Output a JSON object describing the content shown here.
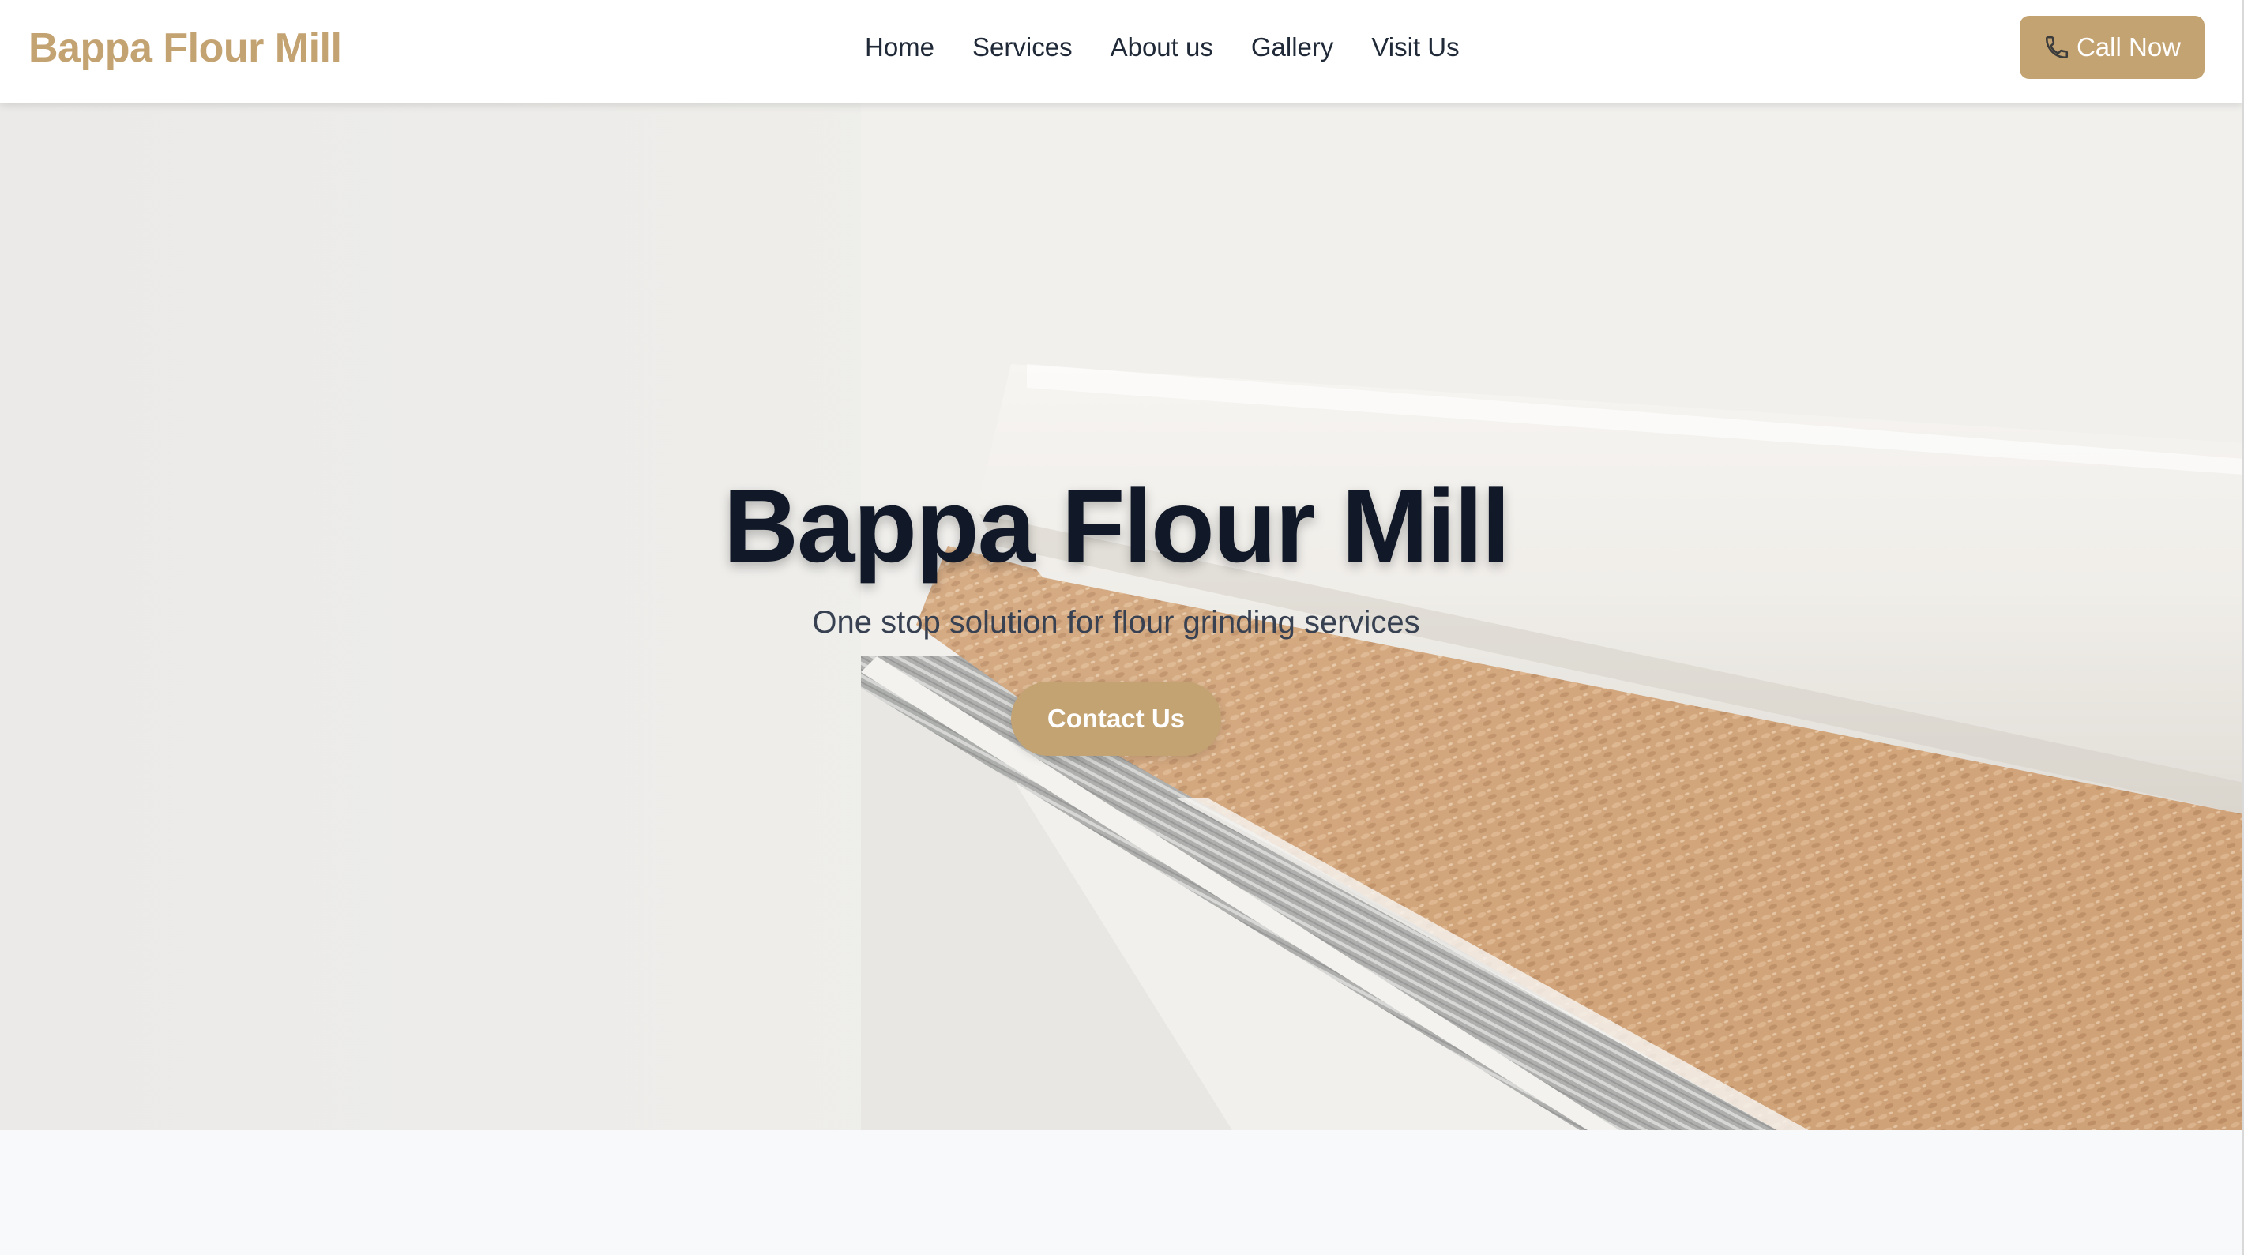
{
  "header": {
    "brand": "Bappa Flour Mill",
    "nav": [
      {
        "label": "Home"
      },
      {
        "label": "Services"
      },
      {
        "label": "About us"
      },
      {
        "label": "Gallery"
      },
      {
        "label": "Visit Us"
      }
    ],
    "call_button": {
      "label": "Call Now",
      "icon": "phone-icon"
    }
  },
  "hero": {
    "title": "Bappa Flour Mill",
    "subtitle": "One stop solution for flour grinding services",
    "cta_label": "Contact Us",
    "background": "wheat grains on a mill conveyor"
  },
  "colors": {
    "accent": "#c4a372",
    "heading": "#111827",
    "nav_text": "#1f2937",
    "page_bg": "#f8f9fb"
  }
}
